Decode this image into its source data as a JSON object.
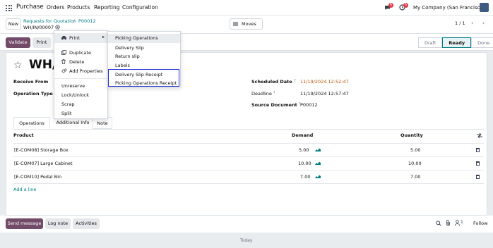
{
  "topnav": {
    "brand": "Purchase",
    "menus": [
      "Orders",
      "Products",
      "Reporting",
      "Configuration"
    ],
    "chat_badge": "6",
    "activity_badge": "6",
    "company": "My Company (San Francisco)"
  },
  "control": {
    "new_label": "New",
    "breadcrumb_root": "Requests for Quotation",
    "breadcrumb_sep": "/",
    "breadcrumb_parent": "P00012",
    "record_name": "WH/IN/00007",
    "moves_label": "Moves",
    "pager": "1 / 1"
  },
  "statusbar": {
    "validate_label": "Validate",
    "print_label": "Print",
    "steps": [
      "Draft",
      "Ready",
      "Done"
    ],
    "active_step": "Ready"
  },
  "form": {
    "title": "WH/IN/00007",
    "receive_from_label": "Receive From",
    "operation_type_label": "Operation Type",
    "scheduled_date_label": "Scheduled Date",
    "scheduled_date_value": "11/19/2024 12:52:47",
    "deadline_label": "Deadline",
    "deadline_value": "11/19/2024 12:57:47",
    "source_document_label": "Source Document",
    "source_document_value": "P00012",
    "help_mark": "?"
  },
  "tabs": [
    "Operations",
    "Additional Info",
    "Note"
  ],
  "table": {
    "headers": {
      "product": "Product",
      "demand": "Demand",
      "quantity": "Quantity"
    },
    "rows": [
      {
        "product": "[E-COM08] Storage Box",
        "demand": "5.00",
        "quantity": "5.00"
      },
      {
        "product": "[E-COM07] Large Cabinet",
        "demand": "10.00",
        "quantity": "10.00"
      },
      {
        "product": "[E-COM10] Pedal Bin",
        "demand": "7.00",
        "quantity": "7.00"
      }
    ],
    "add_line": "Add a line"
  },
  "chatter": {
    "send_message": "Send message",
    "log_note": "Log note",
    "activities": "Activities",
    "followers_count": "1",
    "follow": "Follow",
    "today": "Today"
  },
  "action_menu": {
    "print": "Print",
    "duplicate": "Duplicate",
    "delete": "Delete",
    "add_properties": "Add Properties",
    "unreserve": "Unreserve",
    "lock_unlock": "Lock/Unlock",
    "scrap": "Scrap",
    "split": "Split"
  },
  "print_submenu": {
    "items": [
      "Picking Operations",
      "Delivery Slip",
      "Return slip",
      "Labels",
      "Delivery Slip Receipt",
      "Picking Operations Receipt"
    ]
  },
  "colors": {
    "brand": "#714b67",
    "accent": "#017e84",
    "highlight": "#1f2fd0",
    "badge": "#dc3545"
  }
}
